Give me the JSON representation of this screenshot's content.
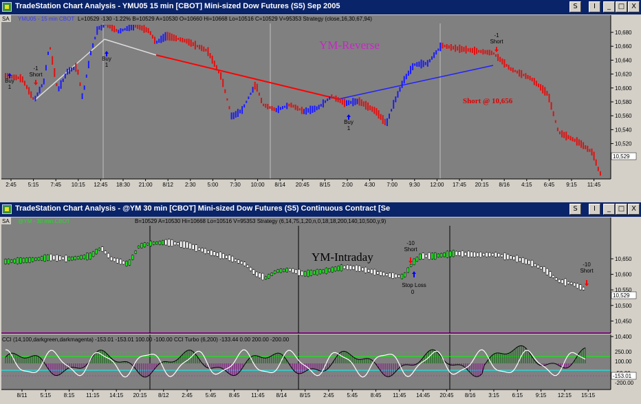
{
  "window1": {
    "title": "TradeStation Chart Analysis - YMU05  15 min  [CBOT] Mini-sized Dow Futures (S5) Sep 2005",
    "status_tag": "SA",
    "status_symbol": "YMU05 - 15 min  CBOT",
    "status_text": "L=10529  -130  -1.22%  B=10529  A=10530  O=10660  Hi=10668  Lo=10516  C=10529  V=95353  Strategy  (close,16,30,67,94)",
    "watermark": "YM-Reverse",
    "annotation_short_price": "Short @ 10,656",
    "price_axis": [
      "10,680",
      "10,660",
      "10,640",
      "10,620",
      "10,600",
      "10,580",
      "10,560",
      "10,540",
      "10,520"
    ],
    "last_price_label": "10,529",
    "time_axis": [
      "2:45",
      "5:15",
      "7:45",
      "10:15",
      "12:45",
      "18:30",
      "21:00",
      "8/12",
      "2:30",
      "5:00",
      "7:30",
      "10:00",
      "8/14",
      "20:45",
      "8/15",
      "2:00",
      "4:30",
      "7:00",
      "9:30",
      "12:00",
      "17:45",
      "20:15",
      "8/16",
      "4:15",
      "6:45",
      "9:15",
      "11:45"
    ],
    "signals": [
      {
        "line1": "Buy",
        "line2": "1"
      },
      {
        "line1": "-1",
        "line2": "Short"
      },
      {
        "line1": "Buy",
        "line2": "1"
      },
      {
        "line1": "Buy",
        "line2": "1"
      },
      {
        "line1": "-1",
        "line2": "Short"
      }
    ]
  },
  "window2": {
    "title": "TradeStation Chart Analysis - @YM  30 min  [CBOT] Mini-sized Dow Futures (S5) Continuous Contract [Se",
    "status_tag": "SA",
    "status_symbol": "@YM - 30 min  CBOT",
    "status_text": "B=10529  A=10530        Hi=10668  Lo=10516        V=95353  Strategy  (6,14,75,1,20,n,0,18,18,200,140,10,500,y,9)",
    "watermark": "YM-Intraday",
    "price_axis": [
      "10,650",
      "10,600",
      "10,550",
      "10,500",
      "10,450",
      "10,400"
    ],
    "last_price_label": "10,529",
    "signals": [
      {
        "line1": "-10",
        "line2": "Short"
      },
      {
        "line1": "Stop Loss",
        "line2": "0"
      },
      {
        "line1": "-10",
        "line2": "Short"
      }
    ],
    "cci_text": "CCI (14,100,darkgreen,darkmagenta)   -153.01  -153.01  100.00  -100.00   CCI Turbo (6,200)   -133.44  0.00  200.00  -200.00",
    "cci_axis": [
      "250.00",
      "100.00",
      "-50.00",
      "-200.00"
    ],
    "cci_last_label": "-153.01",
    "time_axis": [
      "8/11",
      "5:15",
      "8:15",
      "11:15",
      "14:15",
      "20:15",
      "8/12",
      "2:45",
      "5:45",
      "8:45",
      "11:45",
      "8/14",
      "8/15",
      "2:45",
      "5:45",
      "8:45",
      "11:45",
      "14:45",
      "20:45",
      "8/16",
      "3:15",
      "6:15",
      "9:15",
      "12:15",
      "15:15"
    ]
  },
  "buttons": {
    "s": "S",
    "i": "I",
    "min": "_",
    "max": "□",
    "close": "X"
  },
  "colors": {
    "up": "#1a1aff",
    "down": "#e01010",
    "up2": "#22dd22",
    "down2": "#ffffff",
    "bg": "#808080",
    "title": "#0a246a",
    "watermark": "#cc22cc",
    "short_label": "#dd0000"
  }
}
